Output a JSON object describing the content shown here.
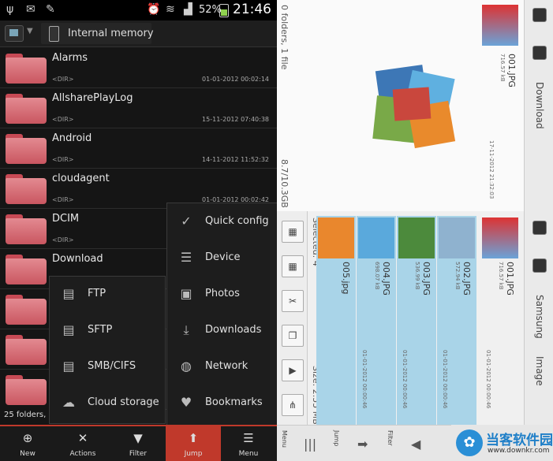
{
  "left": {
    "status_bar": {
      "battery": "52%",
      "time": "21:46"
    },
    "path": {
      "location": "Internal memory"
    },
    "files": [
      {
        "name": "Alarms",
        "type": "<DIR>",
        "date": "01-01-2012 00:02:14"
      },
      {
        "name": "AllsharePlayLog",
        "type": "<DIR>",
        "date": "15-11-2012 07:40:38"
      },
      {
        "name": "Android",
        "type": "<DIR>",
        "date": "14-11-2012 11:52:32"
      },
      {
        "name": "cloudagent",
        "type": "<DIR>",
        "date": "01-01-2012 00:02:42"
      },
      {
        "name": "DCIM",
        "type": "<DIR>",
        "date": ""
      },
      {
        "name": "Download",
        "type": "",
        "date": ""
      }
    ],
    "summary": "25 folders,",
    "network_menu": [
      {
        "icon": "ftp-icon",
        "label": "FTP"
      },
      {
        "icon": "sftp-icon",
        "label": "SFTP"
      },
      {
        "icon": "smb-icon",
        "label": "SMB/CIFS"
      },
      {
        "icon": "cloud-icon",
        "label": "Cloud storage"
      }
    ],
    "jump_menu": [
      {
        "icon": "check-icon",
        "label": "Quick config"
      },
      {
        "icon": "device-icon",
        "label": "Device"
      },
      {
        "icon": "photos-icon",
        "label": "Photos"
      },
      {
        "icon": "download-icon",
        "label": "Downloads"
      },
      {
        "icon": "globe-icon",
        "label": "Network"
      },
      {
        "icon": "heart-icon",
        "label": "Bookmarks"
      }
    ],
    "bottom_bar": [
      {
        "icon": "plus-icon",
        "label": "New"
      },
      {
        "icon": "tools-icon",
        "label": "Actions"
      },
      {
        "icon": "filter-icon",
        "label": "Filter"
      },
      {
        "icon": "jump-icon",
        "label": "Jump"
      },
      {
        "icon": "menu-icon",
        "label": "Menu"
      }
    ]
  },
  "right": {
    "top_panel": {
      "info_left": "0 folders, 1 file",
      "info_right": "8.7/10.3GB",
      "folder_label": "Download",
      "file": {
        "name": "001.JPG",
        "size": "716.57 kB",
        "date": "17-11-2012 21:32:03"
      }
    },
    "bottom_panel": {
      "selected": "Selected: 4",
      "size": "Size: 2.55 MB",
      "folder_labels": [
        "Samsung",
        "Image"
      ],
      "files": [
        {
          "name": "001.JPG",
          "size": "716.57 kB",
          "date": "01-01-2012 00:00:46",
          "selected": false
        },
        {
          "name": "002.JPG",
          "size": "572.94 kB",
          "date": "01-01-2012 00:00:46",
          "selected": true
        },
        {
          "name": "003.JPG",
          "size": "536.99 kB",
          "date": "01-01-2012 00:00:46",
          "selected": true
        },
        {
          "name": "004.JPG",
          "size": "698.07 kB",
          "date": "01-01-2012 00:00:46",
          "selected": true
        },
        {
          "name": "005.jpg",
          "size": "",
          "date": "",
          "selected": true
        }
      ]
    },
    "bottom_bar": [
      {
        "icon": "menu-icon",
        "label": "Menu"
      },
      {
        "icon": "jump-icon",
        "label": "Jump"
      },
      {
        "icon": "filter-icon",
        "label": "Filter"
      }
    ],
    "watermark": {
      "text": "当客软件园",
      "url": "www.downkr.com"
    }
  }
}
